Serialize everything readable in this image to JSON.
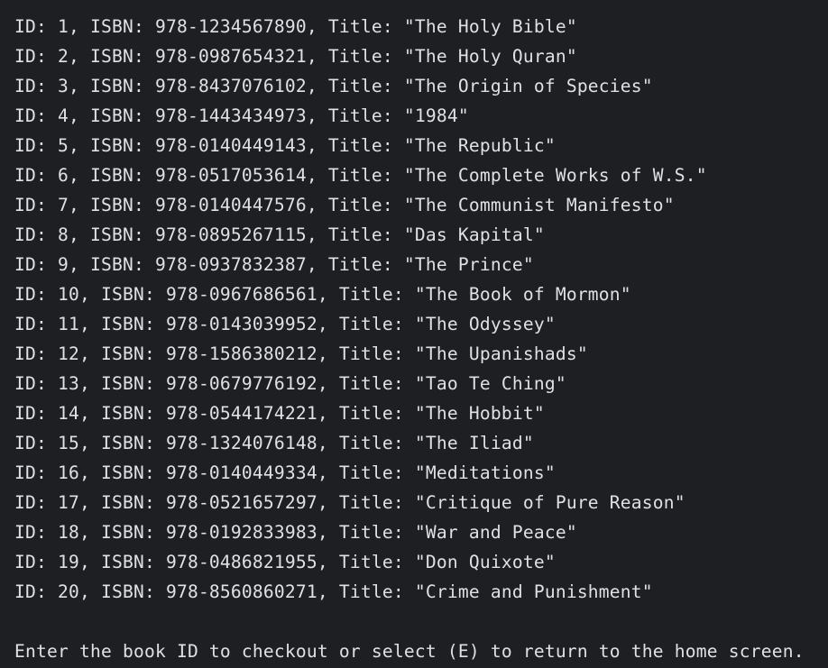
{
  "console": {
    "book_lines": [
      "ID: 1, ISBN: 978-1234567890, Title: \"The Holy Bible\"",
      "ID: 2, ISBN: 978-0987654321, Title: \"The Holy Quran\"",
      "ID: 3, ISBN: 978-8437076102, Title: \"The Origin of Species\"",
      "ID: 4, ISBN: 978-1443434973, Title: \"1984\"",
      "ID: 5, ISBN: 978-0140449143, Title: \"The Republic\"",
      "ID: 6, ISBN: 978-0517053614, Title: \"The Complete Works of W.S.\"",
      "ID: 7, ISBN: 978-0140447576, Title: \"The Communist Manifesto\"",
      "ID: 8, ISBN: 978-0895267115, Title: \"Das Kapital\"",
      "ID: 9, ISBN: 978-0937832387, Title: \"The Prince\"",
      "ID: 10, ISBN: 978-0967686561, Title: \"The Book of Mormon\"",
      "ID: 11, ISBN: 978-0143039952, Title: \"The Odyssey\"",
      "ID: 12, ISBN: 978-1586380212, Title: \"The Upanishads\"",
      "ID: 13, ISBN: 978-0679776192, Title: \"Tao Te Ching\"",
      "ID: 14, ISBN: 978-0544174221, Title: \"The Hobbit\"",
      "ID: 15, ISBN: 978-1324076148, Title: \"The Iliad\"",
      "ID: 16, ISBN: 978-0140449334, Title: \"Meditations\"",
      "ID: 17, ISBN: 978-0521657297, Title: \"Critique of Pure Reason\"",
      "ID: 18, ISBN: 978-0192833983, Title: \"War and Peace\"",
      "ID: 19, ISBN: 978-0486821955, Title: \"Don Quixote\"",
      "ID: 20, ISBN: 978-8560860271, Title: \"Crime and Punishment\""
    ],
    "prompt": "Enter the book ID to checkout or select (E) to return to the home screen."
  },
  "colors": {
    "background": "#1e1f22",
    "text": "#dfe1e5"
  }
}
